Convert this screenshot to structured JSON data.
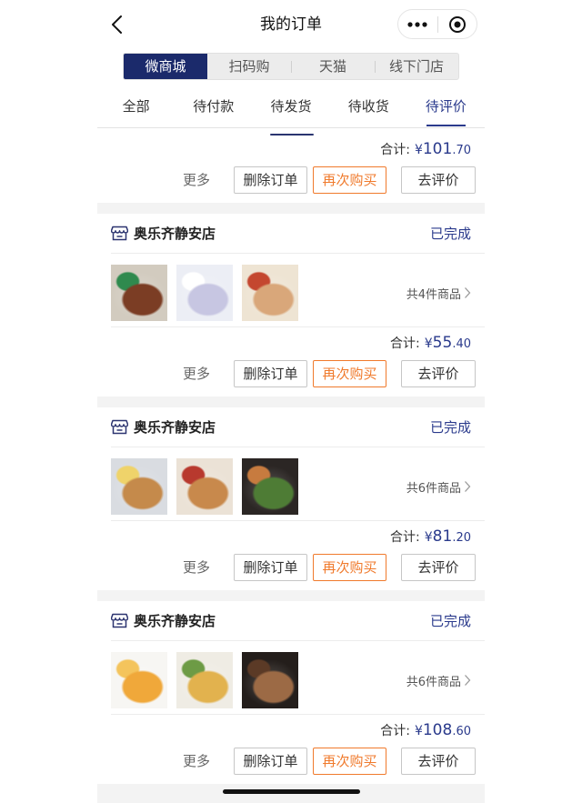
{
  "header": {
    "title": "我的订单",
    "back_icon": "chevron-left-icon",
    "more_icon": "more-dots-icon",
    "exit_icon": "target-circle-icon"
  },
  "channels": {
    "items": [
      {
        "label": "微商城",
        "active": true
      },
      {
        "label": "扫码购",
        "active": false
      },
      {
        "label": "天猫",
        "active": false
      },
      {
        "label": "线下门店",
        "active": false
      }
    ]
  },
  "status_tabs": {
    "items": [
      {
        "label": "全部",
        "active": false
      },
      {
        "label": "待付款",
        "active": false
      },
      {
        "label": "待发货",
        "active": false
      },
      {
        "label": "待收货",
        "active": false
      },
      {
        "label": "待评价",
        "active": true
      }
    ]
  },
  "order_common": {
    "total_label": "合计:",
    "more_label": "更多",
    "delete_label": "删除订单",
    "buy_again_label": "再次购买",
    "review_label": "去评价",
    "store_icon": "store-icon",
    "chevron_icon": "chevron-right-icon"
  },
  "partial_order": {
    "total": {
      "currency": "¥",
      "integer": "101",
      "decimal": ".70"
    }
  },
  "orders": [
    {
      "store": "奥乐齐静安店",
      "status": "已完成",
      "item_count": "共4件商品",
      "total": {
        "currency": "¥",
        "integer": "55",
        "decimal": ".40"
      },
      "thumbnails": [
        {
          "colors": [
            "#d2cbbf",
            "#7b3d24",
            "#2f8a4e"
          ]
        },
        {
          "colors": [
            "#eceef5",
            "#c7c6e2",
            "#ffffff"
          ]
        },
        {
          "colors": [
            "#eee4d3",
            "#d9a77a",
            "#c4472f"
          ]
        }
      ]
    },
    {
      "store": "奥乐齐静安店",
      "status": "已完成",
      "item_count": "共6件商品",
      "total": {
        "currency": "¥",
        "integer": "81",
        "decimal": ".20"
      },
      "thumbnails": [
        {
          "colors": [
            "#d9dce1",
            "#c58a4b",
            "#efd36a"
          ]
        },
        {
          "colors": [
            "#ebe2d6",
            "#c8894c",
            "#b8392e"
          ]
        },
        {
          "colors": [
            "#2b2624",
            "#4e7c35",
            "#c77b3f"
          ]
        }
      ]
    },
    {
      "store": "奥乐齐静安店",
      "status": "已完成",
      "item_count": "共6件商品",
      "total": {
        "currency": "¥",
        "integer": "108",
        "decimal": ".60"
      },
      "thumbnails": [
        {
          "colors": [
            "#f7f6f3",
            "#f0a83a",
            "#f4c45c"
          ]
        },
        {
          "colors": [
            "#efece4",
            "#e2b24e",
            "#6d9b45"
          ]
        },
        {
          "colors": [
            "#241e1b",
            "#9c6a45",
            "#5b3a26"
          ]
        }
      ]
    }
  ],
  "colors": {
    "brand_navy": "#1b2a6b",
    "status_navy": "#2a3a8c",
    "buy_again_orange": "#f07a2c",
    "list_background": "#f3f3f3"
  }
}
